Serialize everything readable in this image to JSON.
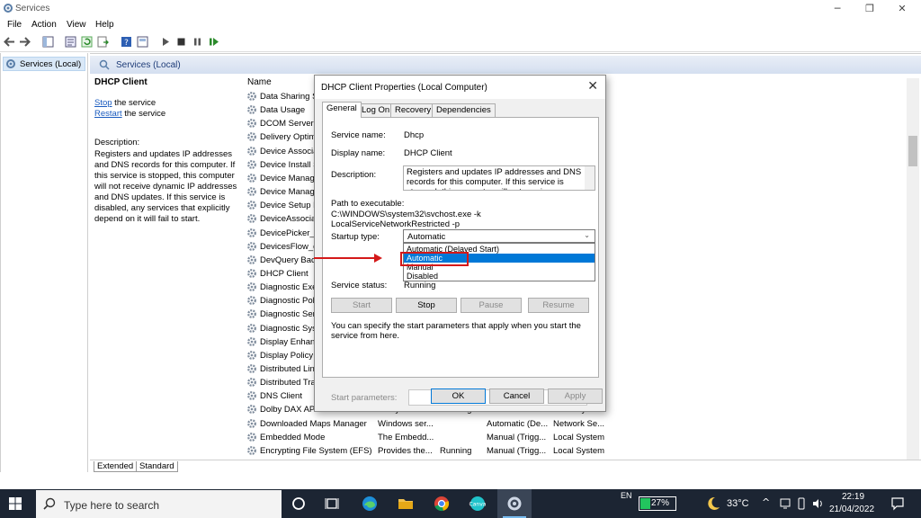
{
  "window": {
    "title": "Services"
  },
  "menu": [
    "File",
    "Action",
    "View",
    "Help"
  ],
  "tree": {
    "item": "Services (Local)"
  },
  "main": {
    "header": "Services (Local)",
    "service_title": "DHCP Client",
    "stop_link": "Stop",
    "stop_rest": " the service",
    "restart_link": "Restart",
    "restart_rest": " the service",
    "description_label": "Description:",
    "description": "Registers and updates IP addresses and DNS records for this computer. If this service is stopped, this computer will not receive dynamic IP addresses and DNS updates. If this service is disabled, any services that explicitly depend on it will fail to start.",
    "name_header": "Name",
    "services": [
      {
        "name": "Data Sharing S"
      },
      {
        "name": "Data Usage"
      },
      {
        "name": "DCOM Server P"
      },
      {
        "name": "Delivery Optim"
      },
      {
        "name": "Device Associat"
      },
      {
        "name": "Device Install S"
      },
      {
        "name": "Device Manage"
      },
      {
        "name": "Device Manage"
      },
      {
        "name": "Device Setup M"
      },
      {
        "name": "DeviceAssociat"
      },
      {
        "name": "DevicePicker_d"
      },
      {
        "name": "DevicesFlow_d"
      },
      {
        "name": "DevQuery Back"
      },
      {
        "name": "DHCP Client"
      },
      {
        "name": "Diagnostic Exe"
      },
      {
        "name": "Diagnostic Poli"
      },
      {
        "name": "Diagnostic Serv"
      },
      {
        "name": "Diagnostic Syst"
      },
      {
        "name": "Display Enhanc"
      },
      {
        "name": "Display Policy S"
      },
      {
        "name": "Distributed Lin"
      },
      {
        "name": "Distributed Tra"
      },
      {
        "name": "DNS Client"
      },
      {
        "name": "Dolby DAX API Service",
        "desc": "Dolby DAX A...",
        "status": "Running",
        "startup": "Automatic",
        "logon": "Local System"
      },
      {
        "name": "Downloaded Maps Manager",
        "desc": "Windows ser...",
        "status": "",
        "startup": "Automatic (De...",
        "logon": "Network Se..."
      },
      {
        "name": "Embedded Mode",
        "desc": "The Embedd...",
        "status": "",
        "startup": "Manual (Trigg...",
        "logon": "Local System"
      },
      {
        "name": "Encrypting File System (EFS)",
        "desc": "Provides the...",
        "status": "Running",
        "startup": "Manual (Trigg...",
        "logon": "Local System"
      }
    ],
    "bottom_tabs": [
      "Extended",
      "Standard"
    ]
  },
  "dialog": {
    "title": "DHCP Client Properties (Local Computer)",
    "tabs": [
      "General",
      "Log On",
      "Recovery",
      "Dependencies"
    ],
    "service_name_label": "Service name:",
    "service_name": "Dhcp",
    "display_name_label": "Display name:",
    "display_name": "DHCP Client",
    "description_label": "Description:",
    "description": "Registers and updates IP addresses and DNS records for this computer. If this service is stopped, this computer will not receive dynamic IP addresses",
    "path_label": "Path to executable:",
    "path": "C:\\WINDOWS\\system32\\svchost.exe -k LocalServiceNetworkRestricted -p",
    "startup_label": "Startup type:",
    "startup_value": "Automatic",
    "startup_options": [
      "Automatic (Delayed Start)",
      "Automatic",
      "Manual",
      "Disabled"
    ],
    "status_label": "Service status:",
    "status_value": "Running",
    "buttons": {
      "start": "Start",
      "stop": "Stop",
      "pause": "Pause",
      "resume": "Resume"
    },
    "hint": "You can specify the start parameters that apply when you start the service from here.",
    "params_label": "Start parameters:",
    "ok": "OK",
    "cancel": "Cancel",
    "apply": "Apply"
  },
  "taskbar": {
    "search_placeholder": "Type here to search",
    "lang": "EN",
    "battery": "27%",
    "temp": "33°C",
    "time": "22:19",
    "date": "21/04/2022"
  },
  "colors": {
    "accent": "#0078d7",
    "highlight": "#d41919",
    "taskbar": "#1c2533"
  }
}
